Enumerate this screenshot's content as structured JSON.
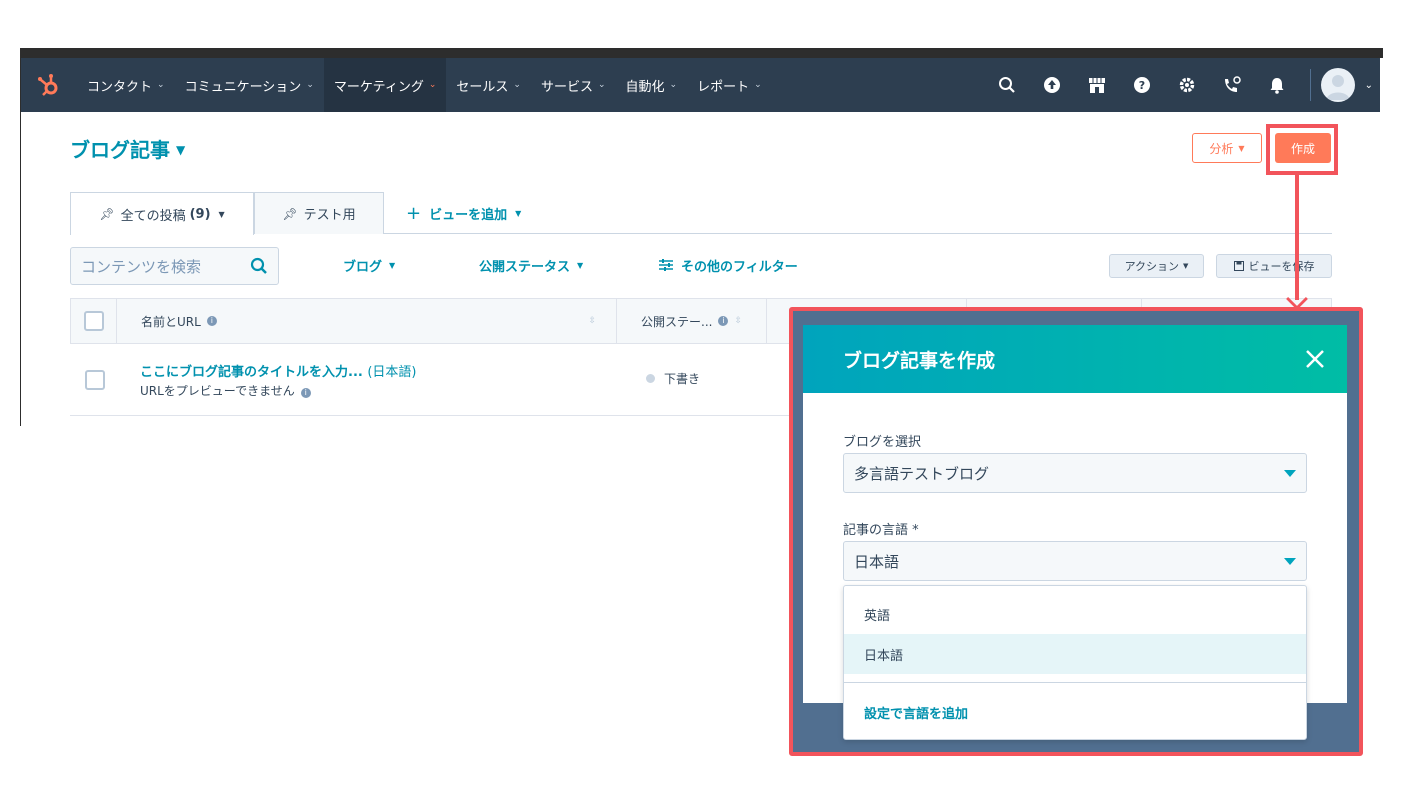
{
  "nav": {
    "items": [
      {
        "label": "コンタクト"
      },
      {
        "label": "コミュニケーション"
      },
      {
        "label": "マーケティング",
        "active": true
      },
      {
        "label": "セールス"
      },
      {
        "label": "サービス"
      },
      {
        "label": "自動化"
      },
      {
        "label": "レポート"
      }
    ],
    "icons": [
      "search-icon",
      "upgrade-icon",
      "marketplace-icon",
      "help-icon",
      "settings-icon",
      "calling-icon",
      "notifications-icon"
    ]
  },
  "page": {
    "title": "ブログ記事",
    "analyze_label": "分析",
    "create_label": "作成"
  },
  "tabs": {
    "all_posts": "全ての投稿",
    "all_posts_count": "(9)",
    "test": "テスト用",
    "add_view": "ビューを追加"
  },
  "filters": {
    "search_placeholder": "コンテンツを検索",
    "blog": "ブログ",
    "publish_status": "公開ステータス",
    "more_filters": "その他のフィルター",
    "actions": "アクション",
    "save_view": "ビューを保存"
  },
  "table": {
    "col_name": "名前とURL",
    "col_status": "公開ステー...",
    "rows": [
      {
        "title": "ここにブログ記事のタイトルを入力...",
        "lang": "(日本語)",
        "sub": "URLをプレビューできません",
        "status": "下書き"
      }
    ]
  },
  "modal": {
    "title": "ブログ記事を作成",
    "blog_label": "ブログを選択",
    "blog_value": "多言語テストブログ",
    "lang_label": "記事の言語 *",
    "lang_value": "日本語",
    "options": [
      "英語",
      "日本語"
    ],
    "selected_option": "日本語",
    "add_language_link": "設定で言語を追加"
  },
  "colors": {
    "accent": "#ff7a59",
    "link": "#0091ae",
    "highlight": "#f2545b",
    "nav_bg": "#2d3e50"
  }
}
